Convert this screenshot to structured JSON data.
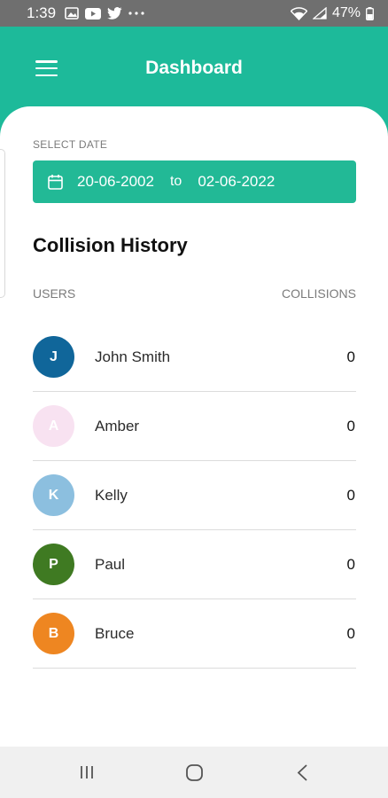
{
  "status_bar": {
    "time": "1:39",
    "battery": "47%",
    "icons": [
      "gallery-icon",
      "youtube-icon",
      "twitter-icon",
      "more-icon",
      "wifi-icon",
      "signal-icon",
      "battery-icon"
    ]
  },
  "header": {
    "title": "Dashboard",
    "menu_icon": "hamburger-menu-icon"
  },
  "date_filter": {
    "label": "SELECT DATE",
    "from": "20-06-2002",
    "separator": "to",
    "until": "02-06-2022"
  },
  "collision_history": {
    "title": "Collision History",
    "columns": {
      "users": "USERS",
      "collisions": "COLLISIONS"
    },
    "rows": [
      {
        "initial": "J",
        "name": "John Smith",
        "collisions": "0",
        "color": "#10669a"
      },
      {
        "initial": "A",
        "name": "Amber",
        "collisions": "0",
        "color": "#f8e2f1"
      },
      {
        "initial": "K",
        "name": "Kelly",
        "collisions": "0",
        "color": "#8cbfdf"
      },
      {
        "initial": "P",
        "name": "Paul",
        "collisions": "0",
        "color": "#3f7a22"
      },
      {
        "initial": "B",
        "name": "Bruce",
        "collisions": "0",
        "color": "#ee8621"
      }
    ]
  },
  "nav_bar": {
    "buttons": [
      "recent-apps-icon",
      "home-icon",
      "back-icon"
    ]
  },
  "colors": {
    "accent": "#1dba9a",
    "status_bar": "#6f6f6f",
    "nav_bar": "#f0f0f0"
  }
}
